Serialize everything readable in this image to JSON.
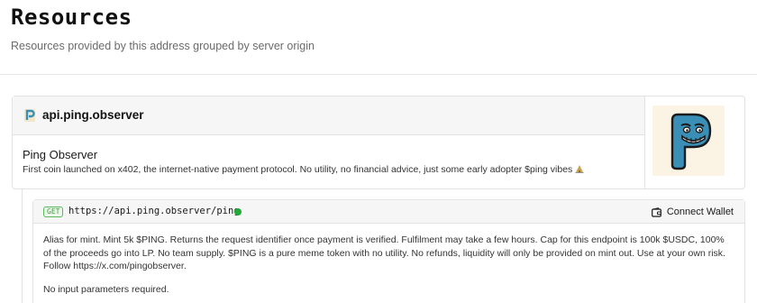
{
  "page": {
    "title": "Resources",
    "subtitle": "Resources provided by this address grouped by server origin"
  },
  "origin": {
    "host": "api.ping.observer",
    "name": "Ping Observer",
    "description": "First coin launched on x402, the internet-native payment protocol. No utility, no financial advice, just some early adopter $ping vibes",
    "favicon_icon": "ping-p-logo-icon",
    "logo_icon": "ping-mascot-logo",
    "brand_color": "#3a8fb7"
  },
  "resource": {
    "method": "GET",
    "url": "https://api.ping.observer/ping",
    "status_color": "#22a93a",
    "connect_label": "Connect Wallet",
    "connect_icon": "wallet-icon",
    "description": "Alias for mint. Mint 5k $PING. Returns the request identifier once payment is verified. Fulfilment may take a few hours. Cap for this endpoint is 100k $USDC, 100% of the proceeds go into LP. No team supply. $PING is a pure meme token with no utility. No refunds, liquidity will only be provided on mint out. Use at your own risk. Follow https://x.com/pingobserver.",
    "params_note": "No input parameters required."
  }
}
